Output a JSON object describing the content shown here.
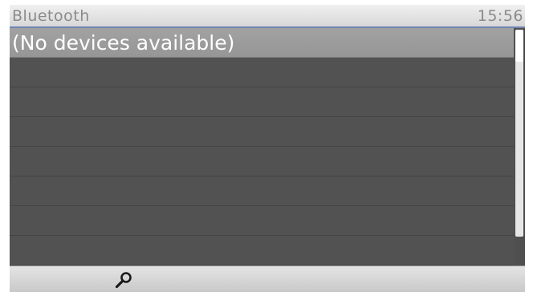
{
  "status_bar": {
    "title": "Bluetooth",
    "clock": "15:56"
  },
  "device_list": {
    "items": [
      {
        "label": "(No devices available)",
        "selected": true
      },
      {
        "label": ""
      },
      {
        "label": ""
      },
      {
        "label": ""
      },
      {
        "label": ""
      },
      {
        "label": ""
      },
      {
        "label": ""
      },
      {
        "label": ""
      }
    ]
  },
  "softkeys": [
    {
      "icon": "search-icon"
    },
    {
      "icon": ""
    },
    {
      "icon": ""
    },
    {
      "icon": ""
    }
  ],
  "colors": {
    "background": "#4f4f4f",
    "selection": "#9c9c9c",
    "status_bar": "#e4e4e4",
    "status_divider": "#6f86b3"
  }
}
